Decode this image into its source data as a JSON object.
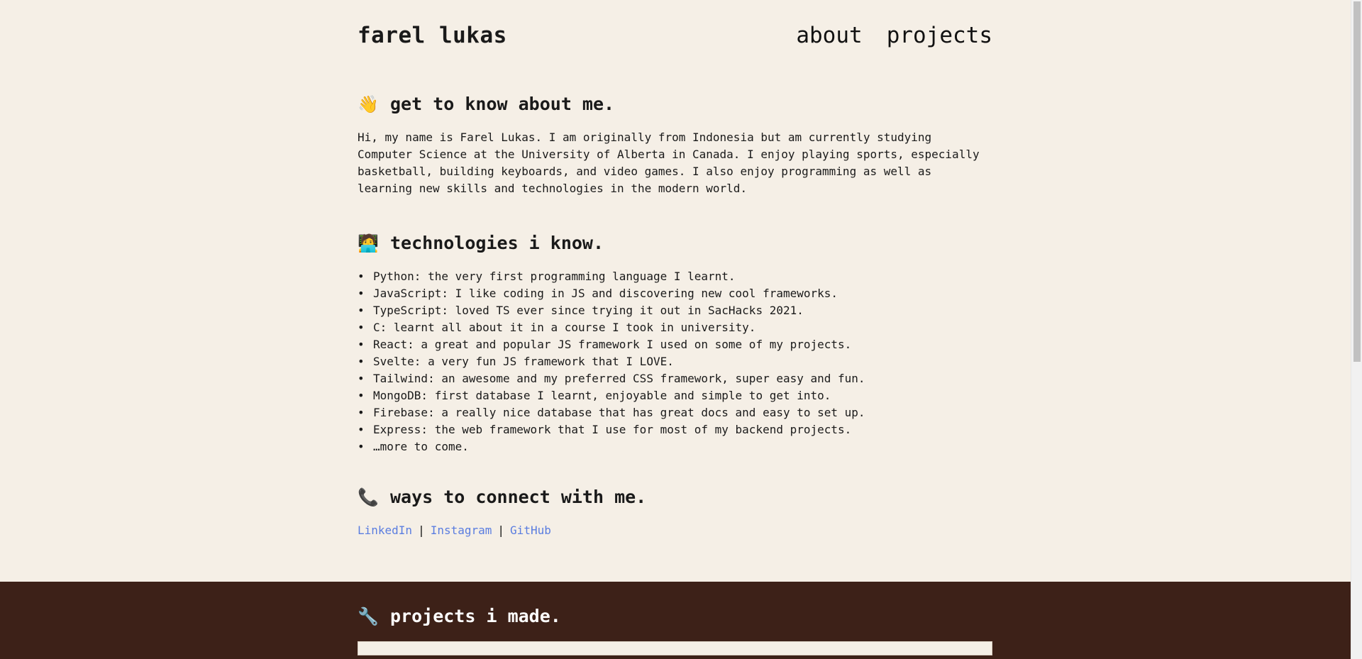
{
  "header": {
    "title": "farel lukas",
    "nav": [
      "about",
      "projects"
    ]
  },
  "about": {
    "emoji": "👋",
    "heading": "get to know about me.",
    "text": "Hi, my name is Farel Lukas. I am originally from Indonesia but am currently studying Computer Science at the University of Alberta in Canada. I enjoy playing sports, especially basketball, building keyboards, and video games. I also enjoy programming as well as learning new skills and technologies in the modern world."
  },
  "technologies": {
    "emoji": "🧑‍💻",
    "heading": "technologies i know.",
    "items": [
      "Python: the very first programming language I learnt.",
      "JavaScript: I like coding in JS and discovering new cool frameworks.",
      "TypeScript: loved TS ever since trying it out in SacHacks 2021.",
      "C: learnt all about it in a course I took in university.",
      "React: a great and popular JS framework I used on some of my projects.",
      "Svelte: a very fun JS framework that I LOVE.",
      "Tailwind: an awesome and my preferred CSS framework, super easy and fun.",
      "MongoDB: first database I learnt, enjoyable and simple to get into.",
      "Firebase: a really nice database that has great docs and easy to set up.",
      "Express: the web framework that I use for most of my backend projects.",
      "…more to come."
    ]
  },
  "connect": {
    "emoji": "📞",
    "heading": "ways to connect with me.",
    "links": [
      "LinkedIn",
      "Instagram",
      "GitHub"
    ],
    "separator": "|"
  },
  "projects": {
    "emoji": "🔧",
    "heading": "projects i made."
  },
  "colors": {
    "background": "#f5efe6",
    "projects_band": "#3d2118",
    "link": "#5a7de0",
    "text": "#1a1a1a"
  }
}
